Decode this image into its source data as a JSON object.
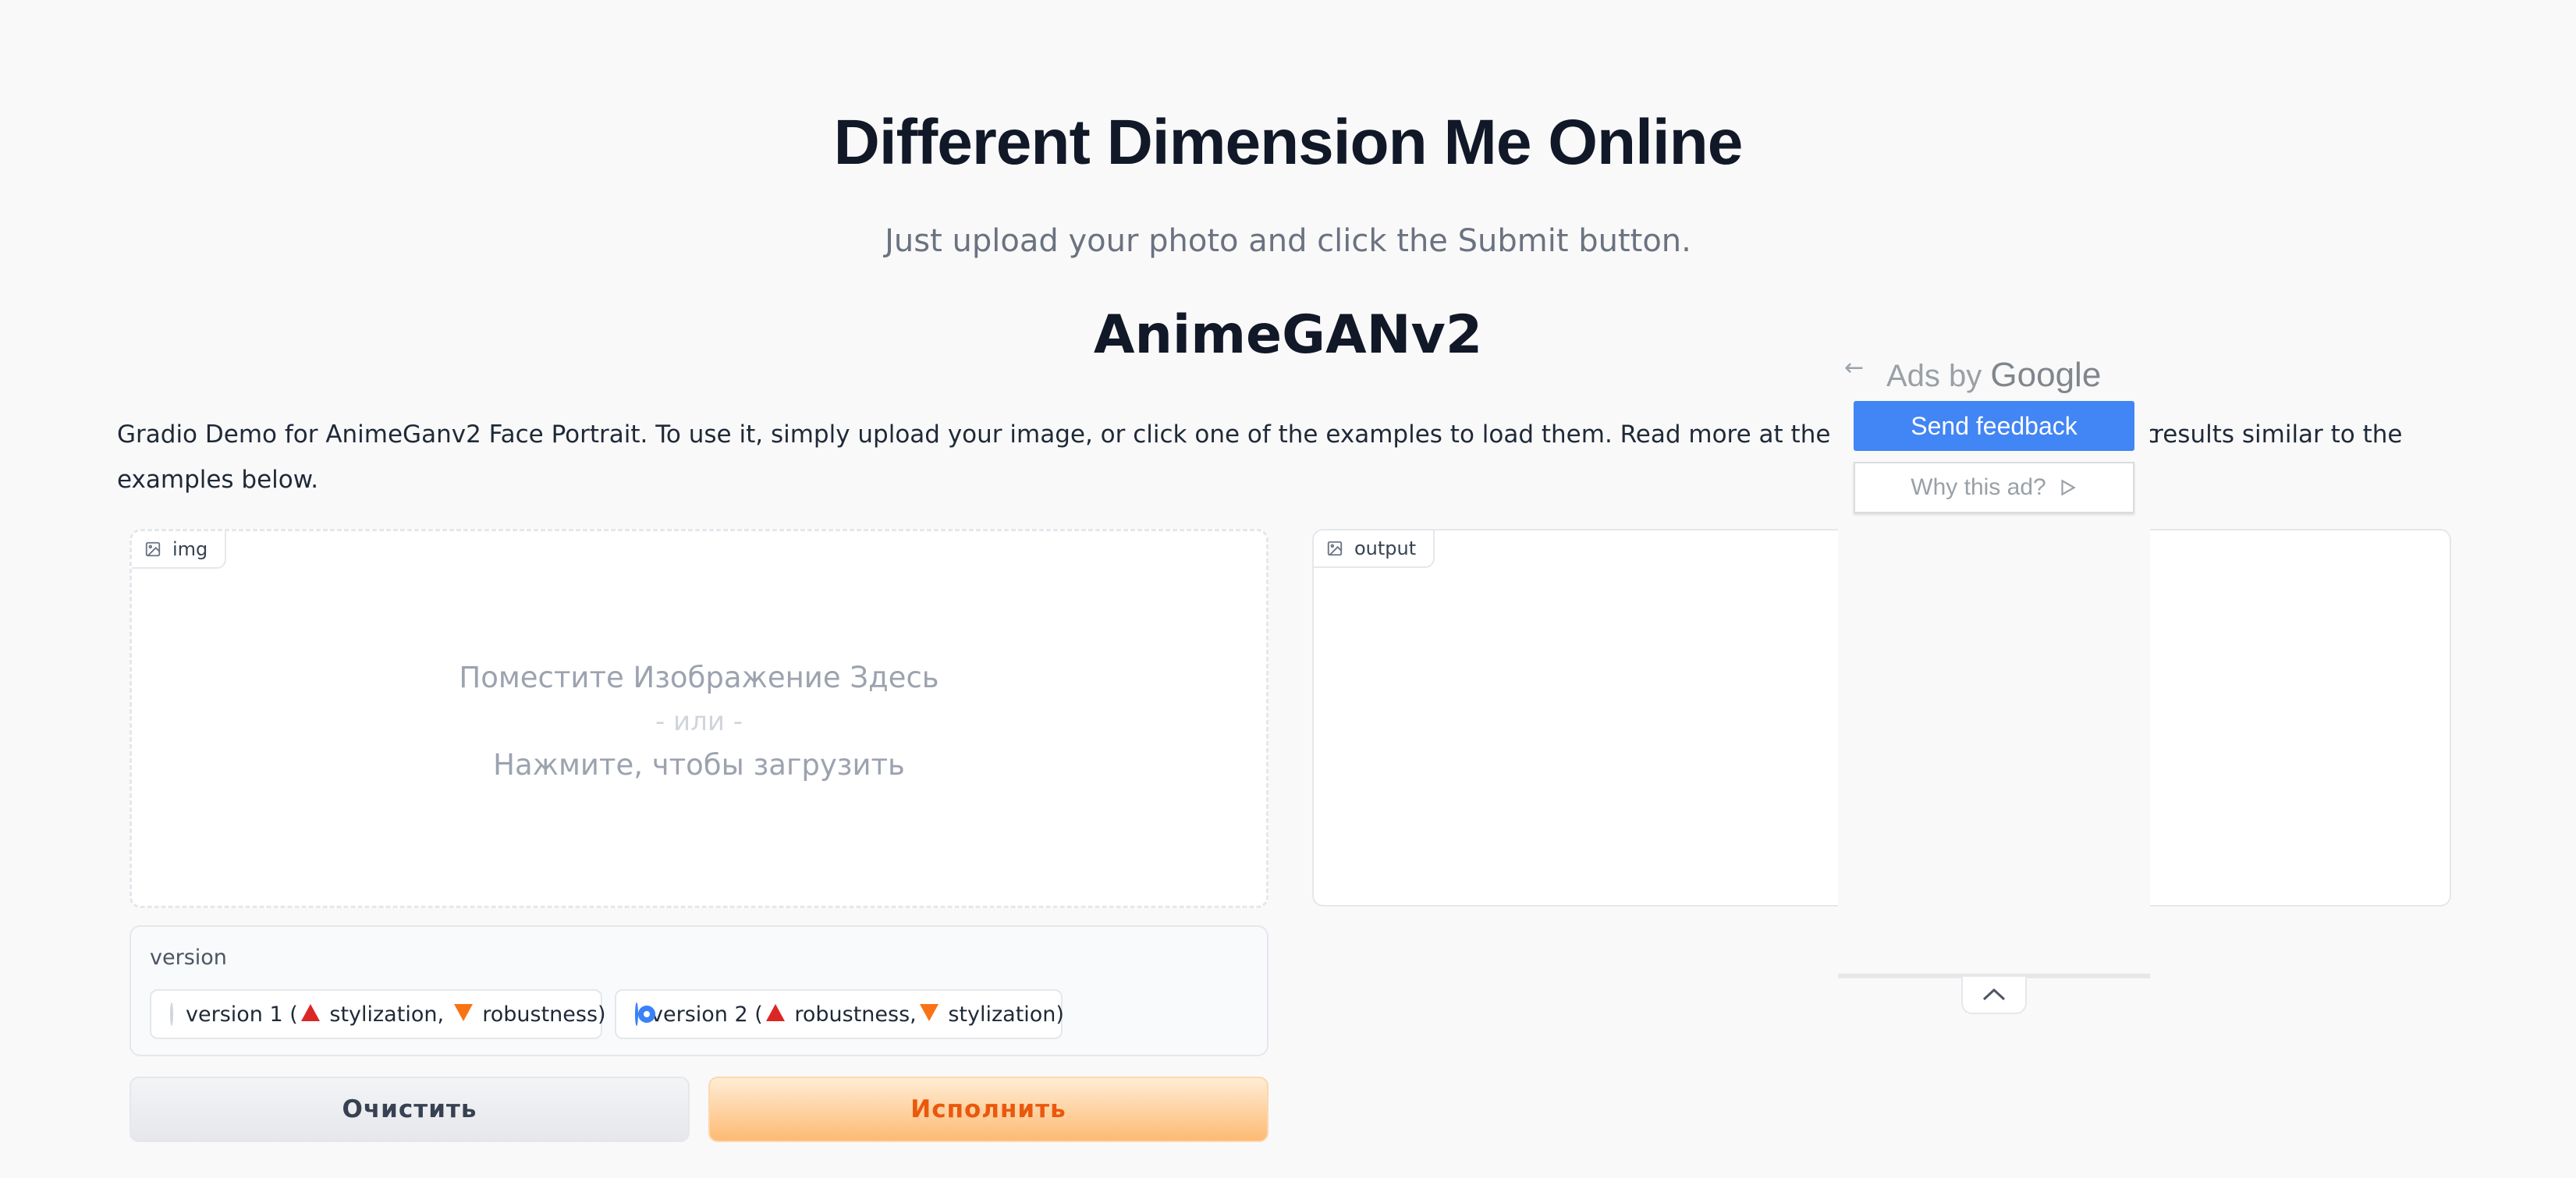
{
  "header": {
    "title": "Different Dimension Me Online",
    "subtitle": "Just upload your photo and click the Submit button."
  },
  "demo": {
    "model_title": "AnimeGANv2",
    "description_line1": "Gradio Demo for AnimeGanv2 Face Portrait. To use it, simply upload your image, or click one of the examples to load them. Read more at the links below. Please use a c",
    "description_line1_end": "st results similar to the",
    "description_line2": "examples below."
  },
  "input_panel": {
    "label": "img",
    "drop_text": "Поместите Изображение Здесь",
    "or_text": "- или -",
    "click_text": "Нажмите, чтобы загрузить"
  },
  "output_panel": {
    "label": "output"
  },
  "version": {
    "label": "version",
    "selected": "version 2",
    "options": [
      {
        "prefix": "version 1 (",
        "a": "stylization,",
        "b": "robustness)"
      },
      {
        "prefix": "version 2 (",
        "a": "robustness,",
        "b": "stylization)"
      }
    ]
  },
  "buttons": {
    "clear": "Очистить",
    "submit": "Исполнить"
  },
  "ad": {
    "back_icon": "←",
    "ads_by": "Ads by",
    "google": "Google",
    "send_feedback": "Send feedback",
    "why_this_ad": "Why this ad?",
    "colors": {
      "feedback_bg": "#4285f4"
    }
  },
  "colors": {
    "accent_orange": "#ea580c",
    "radio_blue": "#3b82f6",
    "triangle_up": "#dc2626",
    "triangle_down": "#f97316"
  }
}
